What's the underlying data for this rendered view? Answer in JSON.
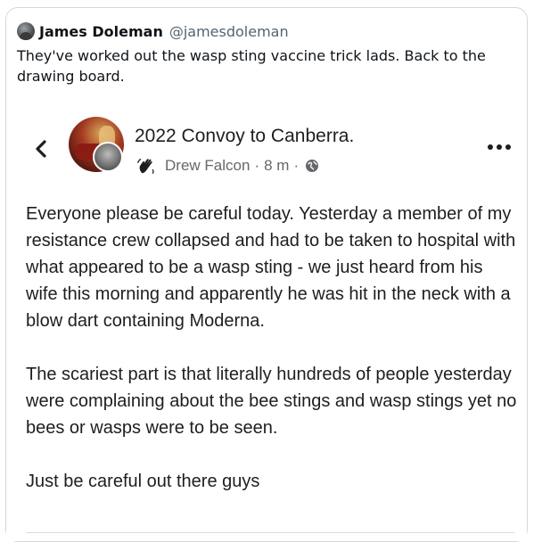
{
  "tweet": {
    "display_name": "James Doleman",
    "handle": "@jamesdoleman",
    "text": "They've worked out the wasp sting vaccine trick lads. Back to the drawing board."
  },
  "fb_post": {
    "group_name": "2022 Convoy to Canberra.",
    "author": "Drew Falcon",
    "time": "8 m",
    "separator": "·",
    "paragraphs": [
      "Everyone please be careful today. Yesterday a member of my resistance crew collapsed and had to be taken to hospital with what appeared to be a wasp sting - we just heard from his wife this morning and apparently he was hit in the neck with a blow dart containing Moderna.",
      "The scariest part is that literally hundreds of people yesterday were complaining about the bee stings and wasp stings yet no bees or wasps were to be seen.",
      "Just be careful out there guys"
    ]
  },
  "icons": {
    "back": "chevron-left-icon",
    "more": "more-dots-icon",
    "audience": "globe-icon",
    "badge": "waving-hand-icon"
  }
}
